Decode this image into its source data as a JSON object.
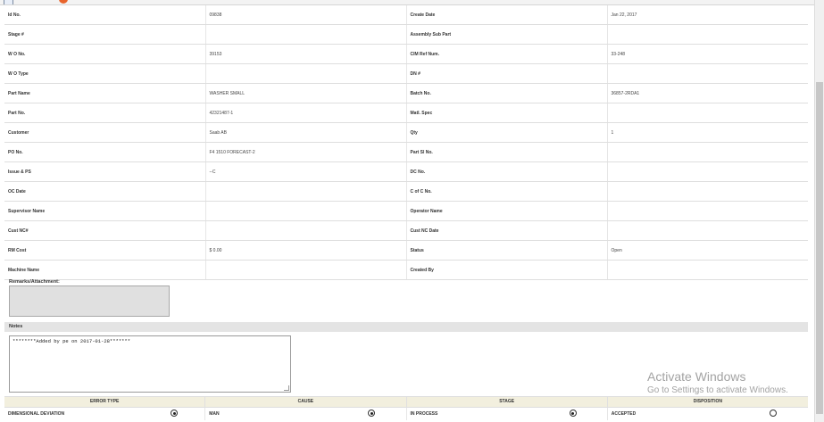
{
  "topbar": {
    "left_text": "",
    "right_text": ""
  },
  "details": {
    "rows": [
      {
        "l1": "Id No.",
        "v1": "09838",
        "l2": "Create Date",
        "v2": "Jan 22, 2017"
      },
      {
        "l1": "Stage #",
        "v1": "",
        "l2": "Assembly Sub Part",
        "v2": ""
      },
      {
        "l1": "W O No.",
        "v1": "39153",
        "l2": "CIM Ref Num.",
        "v2": "33-248"
      },
      {
        "l1": "W O Type",
        "v1": "",
        "l2": "DN #",
        "v2": ""
      },
      {
        "l1": "Part Name",
        "v1": "WASHER SMALL",
        "l2": "Batch No.",
        "v2": "36857-2RDA1"
      },
      {
        "l1": "Part No.",
        "v1": "42321487-1",
        "l2": "Matl. Spec",
        "v2": ""
      },
      {
        "l1": "Customer",
        "v1": "Saab AB",
        "l2": "Qty",
        "v2": "1"
      },
      {
        "l1": "PO No.",
        "v1": "F4 1510 FORECAST-2",
        "l2": "Part Sl No.",
        "v2": ""
      },
      {
        "l1": "Issue & PS",
        "v1": "--C",
        "l2": "DC No.",
        "v2": ""
      },
      {
        "l1": "OC Date",
        "v1": "",
        "l2": "C of C No.",
        "v2": ""
      },
      {
        "l1": "Supervisor Name",
        "v1": "",
        "l2": "Operator Name",
        "v2": ""
      },
      {
        "l1": "Cust NC#",
        "v1": "",
        "l2": "Cust NC Date",
        "v2": ""
      },
      {
        "l1": "RM Cost",
        "v1": "$ 0.00",
        "l2": "Status",
        "v2": "Open"
      },
      {
        "l1": "Machine Name",
        "v1": "",
        "l2": "Created By",
        "v2": ""
      }
    ]
  },
  "remarks": {
    "label": "Remarks/Attachment:",
    "value": ""
  },
  "notes": {
    "label": "Notes",
    "value": "********Added by pe on 2017-01-28*******"
  },
  "errors": {
    "headers": [
      "ERROR TYPE",
      "CAUSE",
      "STAGE",
      "DISPOSITION"
    ],
    "row": {
      "error_type": "DIMENSIONAL DEVIATION",
      "error_type_selected": true,
      "cause": "MAN",
      "cause_selected": true,
      "stage": "IN PROCESS",
      "stage_selected": true,
      "disposition": "ACCEPTED",
      "disposition_selected": false
    }
  },
  "watermark": {
    "line1": "Activate Windows",
    "line2": "Go to Settings to activate Windows."
  }
}
